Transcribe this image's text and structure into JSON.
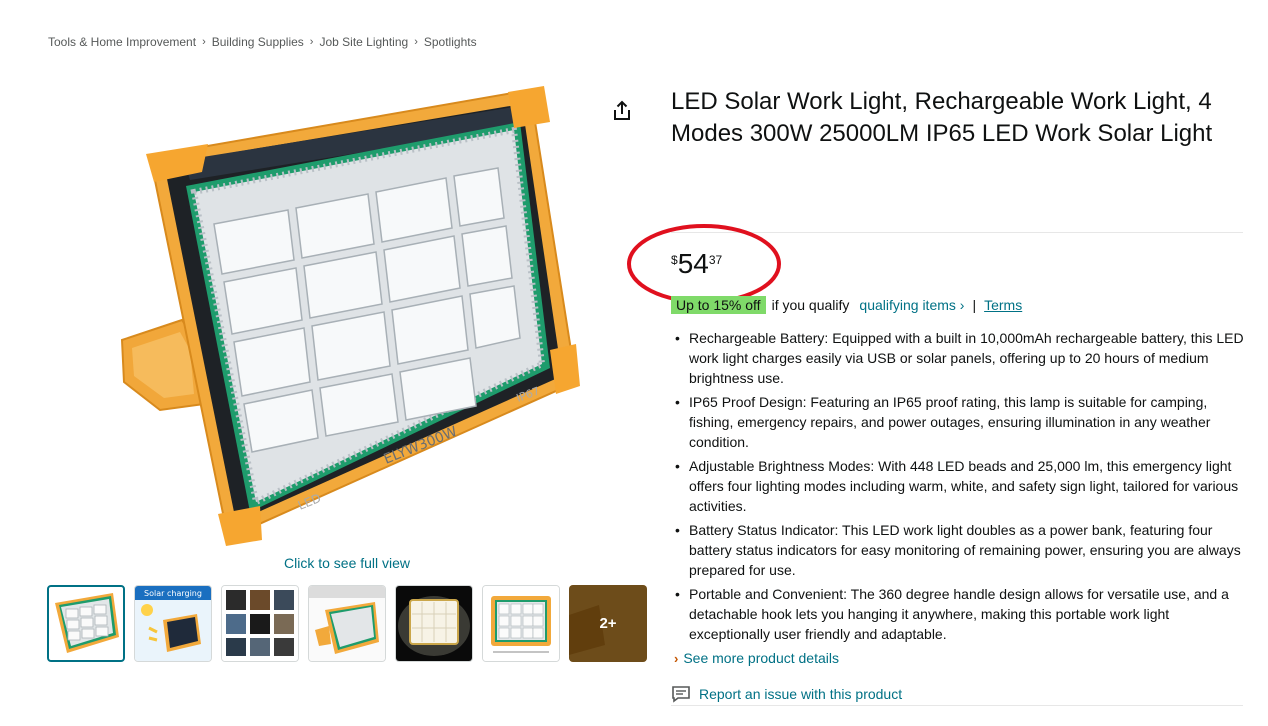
{
  "breadcrumb": [
    "Tools & Home Improvement",
    "Building Supplies",
    "Job Site Lighting",
    "Spotlights"
  ],
  "breadcrumb_separator": "›",
  "gallery": {
    "full_view_label": "Click to see full view",
    "thumbnails": [
      {
        "name": "thumb-main"
      },
      {
        "name": "thumb-solar-charging",
        "caption": "Solar charging"
      },
      {
        "name": "thumb-scenes"
      },
      {
        "name": "thumb-with-stand"
      },
      {
        "name": "thumb-lit"
      },
      {
        "name": "thumb-dimensions"
      },
      {
        "name": "thumb-more",
        "more_label": "2+"
      }
    ],
    "lamp_text": {
      "model": "ELYW300W",
      "rating": "IP67",
      "brand": "LED"
    }
  },
  "product": {
    "title": "LED Solar Work Light, Rechargeable Work Light, 4 Modes 300W 25000LM IP65 LED Work Solar Light",
    "price": {
      "symbol": "$",
      "whole": "54",
      "fraction": "37"
    },
    "promo": {
      "badge": "Up to 15% off",
      "qualify_text": "if you qualify",
      "qualifying_link": "qualifying items ›",
      "separator": "|",
      "terms_link": "Terms"
    },
    "bullets": [
      "Rechargeable Battery: Equipped with a built in 10,000mAh rechargeable battery, this LED work light charges easily via USB or solar panels, offering up to 20 hours of medium brightness use.",
      "IP65 Proof Design: Featuring an IP65 proof rating, this lamp is suitable for camping, fishing, emergency repairs, and power outages, ensuring illumination in any weather condition.",
      "Adjustable Brightness Modes: With 448 LED beads and 25,000 lm, this emergency light offers four lighting modes including warm, white, and safety sign light, tailored for various activities.",
      "Battery Status Indicator: This LED work light doubles as a power bank, featuring four battery status indicators for easy monitoring of remaining power, ensuring you are always prepared for use.",
      "Portable and Convenient: The 360 degree handle design allows for versatile use, and a detachable hook lets you hanging it anywhere, making this portable work light exceptionally user friendly and adaptable."
    ],
    "see_more": {
      "chevron": "›",
      "label": "See more product details"
    },
    "report_issue": "Report an issue with this product"
  },
  "colors": {
    "link": "#007185",
    "promo_badge": "#7fda69",
    "annotation_circle": "#e0101e",
    "frame_orange": "#f2a93b",
    "frame_green": "#1f9e6a"
  }
}
